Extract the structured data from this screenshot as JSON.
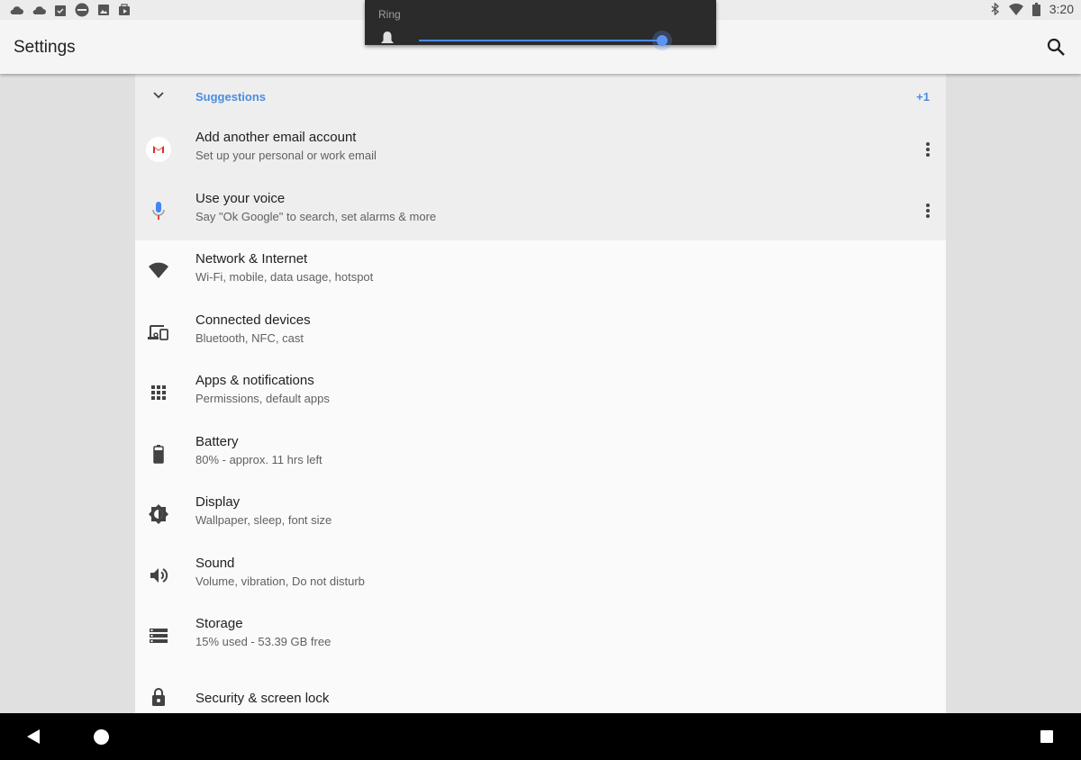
{
  "status_bar": {
    "time": "3:20",
    "left_icons": [
      "cloud-icon",
      "cloud-icon",
      "clipboard-check-icon",
      "cloud-badge-icon",
      "image-icon",
      "play-store-icon"
    ],
    "right_icons": [
      "bluetooth-icon",
      "wifi-icon",
      "battery-icon"
    ]
  },
  "volume_panel": {
    "label": "Ring",
    "icon": "bell-icon",
    "level": 1.0
  },
  "app_bar": {
    "title": "Settings",
    "search_icon": "search-icon"
  },
  "suggestions": {
    "title": "Suggestions",
    "count": "+1",
    "expand_icon": "chevron-down-icon",
    "items": [
      {
        "title": "Add another email account",
        "subtitle": "Set up your personal or work email",
        "icon": "gmail-icon"
      },
      {
        "title": "Use your voice",
        "subtitle": "Say \"Ok Google\" to search, set alarms & more",
        "icon": "mic-icon"
      }
    ]
  },
  "settings": [
    {
      "title": "Network & Internet",
      "subtitle": "Wi-Fi, mobile, data usage, hotspot",
      "icon": "wifi-icon"
    },
    {
      "title": "Connected devices",
      "subtitle": "Bluetooth, NFC, cast",
      "icon": "devices-icon"
    },
    {
      "title": "Apps & notifications",
      "subtitle": "Permissions, default apps",
      "icon": "apps-grid-icon"
    },
    {
      "title": "Battery",
      "subtitle": "80% - approx. 11 hrs left",
      "icon": "battery-icon"
    },
    {
      "title": "Display",
      "subtitle": "Wallpaper, sleep, font size",
      "icon": "brightness-icon"
    },
    {
      "title": "Sound",
      "subtitle": "Volume, vibration, Do not disturb",
      "icon": "volume-icon"
    },
    {
      "title": "Storage",
      "subtitle": "15% used - 53.39 GB free",
      "icon": "storage-icon"
    },
    {
      "title": "Security & screen lock",
      "subtitle": "",
      "icon": "lock-icon"
    }
  ],
  "colors": {
    "accent": "#4a8de0",
    "suggestion_bg": "#eeeeee",
    "list_bg": "#fafafa",
    "volume_panel_bg": "#2b2b2b"
  }
}
